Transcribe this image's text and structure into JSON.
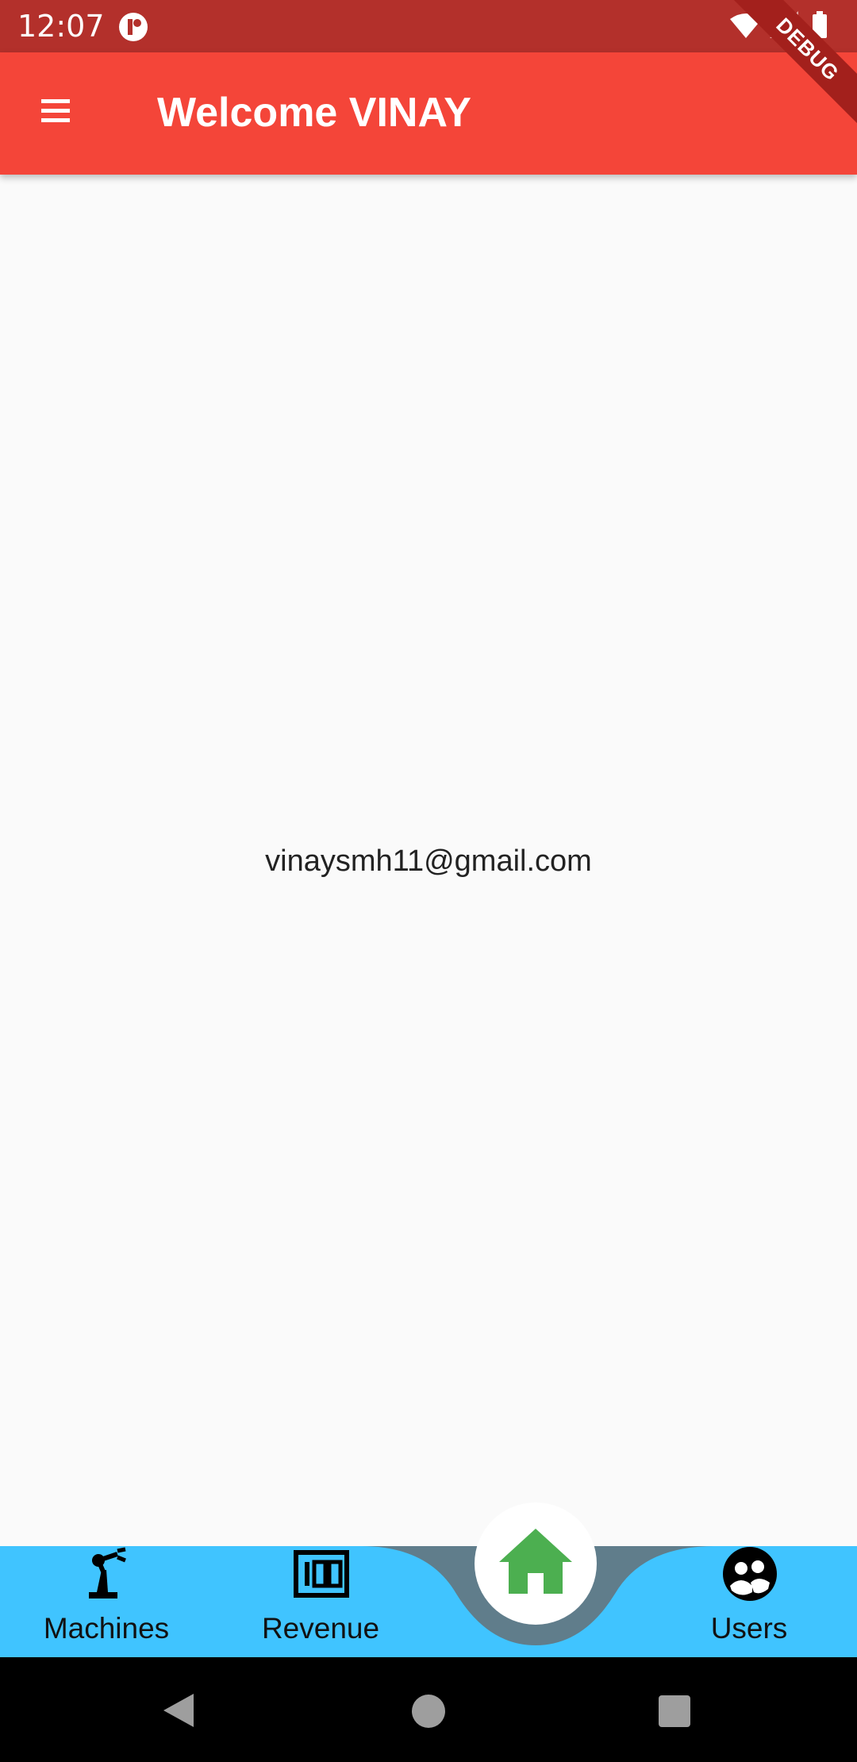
{
  "status_bar": {
    "time": "12:07"
  },
  "app_bar": {
    "title": "Welcome VINAY"
  },
  "debug_banner": {
    "label": "DEBUG"
  },
  "content": {
    "email": "vinaysmh11@gmail.com"
  },
  "bottom_nav": {
    "items": [
      {
        "label": "Machines",
        "icon": "robot-arm-icon"
      },
      {
        "label": "Revenue",
        "icon": "counter-100-icon"
      },
      {
        "label": "",
        "icon": "home-icon"
      },
      {
        "label": "Users",
        "icon": "users-icon"
      }
    ]
  },
  "colors": {
    "status_bar": "#B3302B",
    "app_bar": "#F44539",
    "bottom_nav": "#40C4FF",
    "notch": "#607D8B",
    "home_icon": "#4CAF50"
  }
}
